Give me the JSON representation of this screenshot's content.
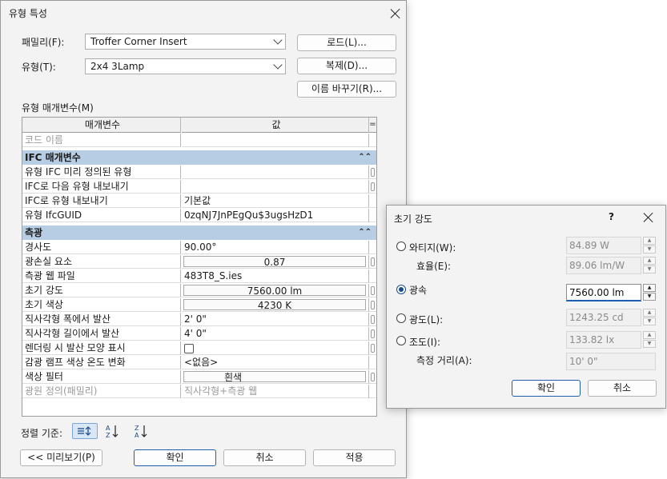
{
  "type_props": {
    "title": "유형 특성",
    "family_label": "패밀리(F):",
    "family_value": "Troffer Corner Insert",
    "type_label": "유형(T):",
    "type_value": "2x4 3Lamp",
    "load_button": "로드(L)...",
    "duplicate_button": "복제(D)...",
    "rename_button": "이름 바꾸기(R)...",
    "params_label": "유형 매개변수(M)",
    "col_param": "매개변수",
    "col_value": "값",
    "col_eq": "=",
    "code_row": "코드 이름",
    "groups": {
      "ifc": "IFC 매개변수",
      "photometric": "측광"
    },
    "ifc_rows": [
      {
        "name": "유형 IFC 미리 정의된 유형",
        "value": ""
      },
      {
        "name": "IFC로 다음 유형 내보내기",
        "value": ""
      },
      {
        "name": "IFC로 유형 내보내기",
        "value": "기본값"
      },
      {
        "name": "유형 IfcGUID",
        "value": "0zqNJ7JnPEgQu$3ugsHzD1"
      }
    ],
    "photo_rows": [
      {
        "name": "경사도",
        "value": "90.00°"
      },
      {
        "name": "광손실 요소",
        "value": "0.87"
      },
      {
        "name": "측광 웹 파일",
        "value": "483T8_S.ies"
      },
      {
        "name": "초기 강도",
        "value": "7560.00 lm"
      },
      {
        "name": "초기 색상",
        "value": "4230 K"
      },
      {
        "name": "직사각형 폭에서 발산",
        "value": "2'  0\""
      },
      {
        "name": "직사각형 길이에서 발산",
        "value": "4'  0\""
      },
      {
        "name": "렌더링 시 발산 모양 표시",
        "value": ""
      },
      {
        "name": "감광 램프 색상 온도 변화",
        "value": "<없음>"
      },
      {
        "name": "색상 필터",
        "value": "흰색"
      },
      {
        "name": "광원 정의(패밀리)",
        "value": "직사각형+측광 웹"
      }
    ],
    "sort_label": "정렬 기준:",
    "preview_button": "<< 미리보기(P)",
    "ok_button": "확인",
    "cancel_button": "취소",
    "apply_button": "적용"
  },
  "intensity": {
    "title": "초기 강도",
    "help": "?",
    "wattage_label": "와티지(W):",
    "wattage_value": "84.89 W",
    "efficacy_label": "효율(E):",
    "efficacy_value": "89.06 lm/W",
    "flux_label": "광속",
    "flux_value": "7560.00 lm",
    "intensity_label": "광도(L):",
    "intensity_value": "1243.25 cd",
    "illuminance_label": "조도(I):",
    "illuminance_value": "133.82 lx",
    "distance_label": "측정 거리(A):",
    "distance_value": "10'  0\"",
    "ok_button": "확인",
    "cancel_button": "취소"
  },
  "colors": {
    "group_header": "#b7cde3",
    "primary_border": "#1f5fae",
    "radio_selected": "#1a4c8c"
  }
}
